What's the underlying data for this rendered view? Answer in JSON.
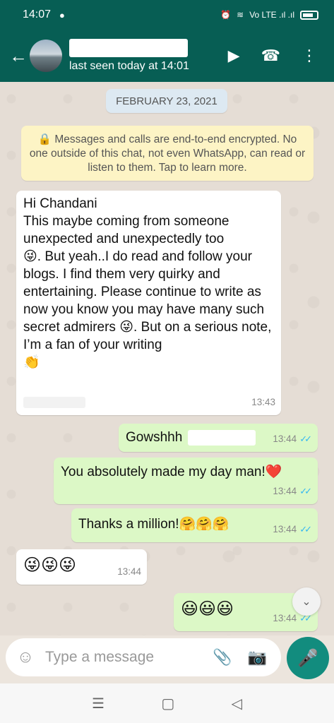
{
  "status_bar": {
    "time": "14:07",
    "right_text": "Vo LTE .ıl .ıl",
    "accent": "#075e54"
  },
  "header": {
    "status": "last seen today at 14:01",
    "icons": [
      "arrow-left-icon",
      "video-icon",
      "phone-icon",
      "more-vertical-icon"
    ]
  },
  "chat": {
    "date_label": "FEBRUARY 23, 2021",
    "encryption_note": "🔒 Messages and calls are end-to-end encrypted. No one outside of this chat, not even WhatsApp, can read or listen to them. Tap to learn more.",
    "messages": [
      {
        "direction": "in",
        "text": "Hi Chandani\nThis maybe coming from someone unexpected and unexpectedly too\n😜. But yeah..I do read and follow your blogs. I find them very quirky and entertaining. Please continue to write as now you know you may have many such secret admirers 😜. But on a serious note, I’m a fan of your writing\n👏",
        "time": "13:43"
      },
      {
        "direction": "out",
        "text": "Gowshhh",
        "time": "13:44",
        "ticks": "✓✓"
      },
      {
        "direction": "out",
        "text": "You absolutely made my day man!❤️",
        "time": "13:44",
        "ticks": "✓✓"
      },
      {
        "direction": "out",
        "text": "Thanks a million!🤗🤗🤗",
        "time": "13:44",
        "ticks": "✓✓"
      },
      {
        "direction": "in",
        "text": "😜😜😜",
        "time": "13:44"
      },
      {
        "direction": "out",
        "text": "😃😃😃",
        "time": "13:44",
        "ticks": "✓✓"
      }
    ]
  },
  "input": {
    "placeholder": "Type a message"
  },
  "colors": {
    "incoming": "#ffffff",
    "outgoing": "#dcf8c6",
    "tick_blue": "#34b7f1",
    "fab": "#128c7e"
  }
}
